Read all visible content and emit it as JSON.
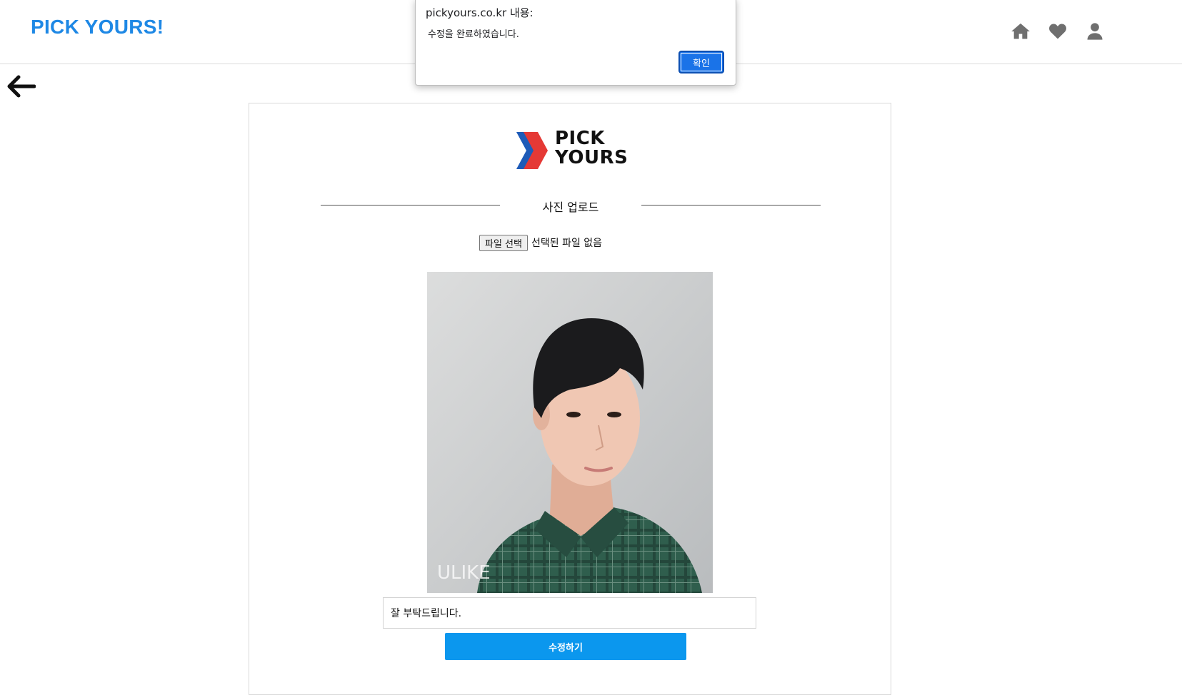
{
  "header": {
    "brand": "PICK YOURS!",
    "icons": [
      "home-icon",
      "heart-icon",
      "user-icon"
    ]
  },
  "navigation": {
    "back_icon": "arrow-left-icon"
  },
  "card": {
    "logo_line1": "PICK",
    "logo_line2": "YOURS",
    "section_title": "사진 업로드",
    "file_button_label": "파일 선택",
    "file_status": "선택된 파일 없음",
    "photo_watermark": "ULIKE",
    "comment_value": "잘 부탁드립니다.",
    "submit_label": "수정하기"
  },
  "dialog": {
    "title": "pickyours.co.kr 내용:",
    "message": "수정을 완료하였습니다.",
    "ok_label": "확인"
  },
  "colors": {
    "brand_blue": "#1e88e5",
    "submit_blue": "#0b97ee",
    "dialog_button": "#1a73e8",
    "icon_gray": "#6f6f6f",
    "logo_red": "#e53935",
    "logo_blue": "#1e5bb8"
  }
}
